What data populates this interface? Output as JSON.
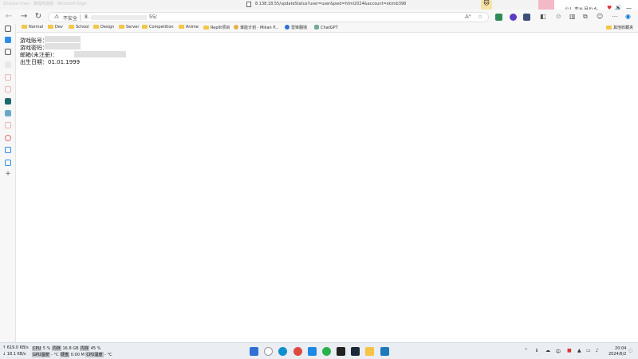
{
  "window": {
    "tab_title": "8.138.18.55/updateStatus?user=user&pwd=html2024&account=skimb398",
    "ghost_text": "Zhenjie Chen · 教程简易版 · Microsoft Edge"
  },
  "media_overlay": {
    "song": "少し恋も見れた",
    "heart": "♥",
    "volume": "🔊",
    "minimize": "—"
  },
  "toolbar": {
    "back": "←",
    "forward": "→",
    "reload": "↻",
    "warning_icon": "⚠",
    "insecure_label": "不安全",
    "url_prefix": "8.",
    "url_suffix": "55/",
    "read_aloud": "Aᴬ",
    "favorite": "☆"
  },
  "bookmarks": {
    "items": [
      {
        "label": "Normal",
        "icon": "folder-icon"
      },
      {
        "label": "Dev",
        "icon": "folder-icon"
      },
      {
        "label": "School",
        "icon": "folder-icon"
      },
      {
        "label": "Design",
        "icon": "folder-icon"
      },
      {
        "label": "Server",
        "icon": "folder-icon"
      },
      {
        "label": "Competition",
        "icon": "folder-icon"
      },
      {
        "label": "Anime",
        "icon": "folder-icon"
      },
      {
        "label": "Replit项目",
        "icon": "folder-icon"
      },
      {
        "label": "谁能计划 - Mikan P...",
        "icon": "mikan-icon"
      },
      {
        "label": "雷锋翻墙",
        "icon": "globe-icon"
      },
      {
        "label": "ChatGPT",
        "icon": "chatgpt-icon"
      }
    ],
    "other_favorites": "其他收藏夹"
  },
  "content": {
    "account_label": "游戏账号：",
    "password_label": "游戏密码：",
    "email_label": "邮箱(未注册)：",
    "birthday_label": "出生日期：",
    "birthday_value": "01.01.1999"
  },
  "taskbar": {
    "upload": "↑ 619.0 KB/s",
    "download": "↓ 18.1 KB/s",
    "cpu_label": "CPU",
    "cpu_value": "5 %",
    "memory_label": "内存",
    "memory_value": "16.8 GB",
    "memory_pct_label": "内存",
    "memory_pct": "45 %",
    "gpu_label": "GPU温度",
    "gpu_value": "- °C",
    "disk_label": "硬盘",
    "disk_value": "0.00 M",
    "temp_label": "CPU温度",
    "temp_value": "- °C",
    "ime": "中",
    "time": "20:04",
    "date": "2024/6/2"
  },
  "colors": {
    "accent": "#0078d4",
    "folder": "#f3c648",
    "redaction": "#e0e0e0"
  }
}
